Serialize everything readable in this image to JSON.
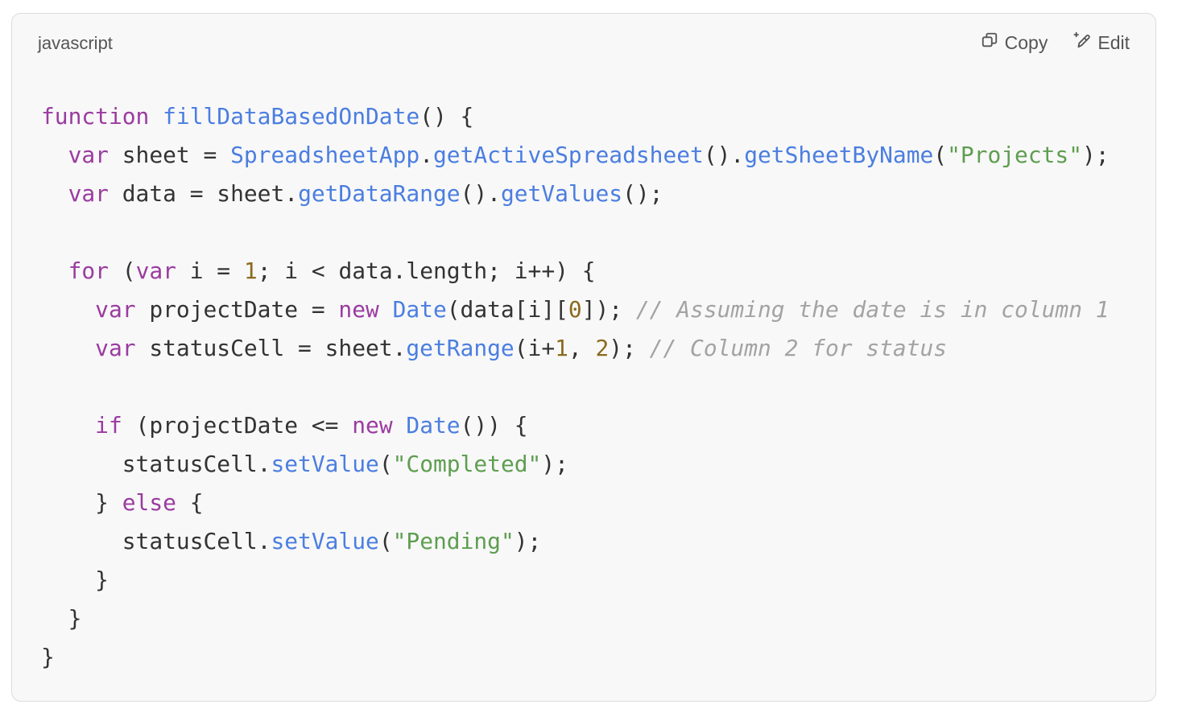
{
  "code_block": {
    "language": "javascript",
    "actions": {
      "copy_label": "Copy",
      "copy_icon": "copy-icon",
      "edit_label": "Edit",
      "edit_icon": "pencil-sparkle-icon"
    },
    "colors": {
      "keyword": "#9a3ba0",
      "function": "#4b7ee0",
      "string": "#5e9e50",
      "number": "#8b6a1e",
      "comment": "#a3a3a3",
      "text": "#333333",
      "background": "#f8f8f8"
    },
    "lines": [
      [
        [
          "kw",
          "function"
        ],
        [
          "",
          " "
        ],
        [
          "fn",
          "fillDataBasedOnDate"
        ],
        [
          "",
          "() {"
        ]
      ],
      [
        [
          "",
          "  "
        ],
        [
          "kw",
          "var"
        ],
        [
          "",
          " sheet = "
        ],
        [
          "fn",
          "SpreadsheetApp"
        ],
        [
          "",
          "."
        ],
        [
          "fn",
          "getActiveSpreadsheet"
        ],
        [
          "",
          "()."
        ],
        [
          "fn",
          "getSheetByName"
        ],
        [
          "",
          "("
        ],
        [
          "str",
          "\"Projects\""
        ],
        [
          "",
          ");"
        ]
      ],
      [
        [
          "",
          "  "
        ],
        [
          "kw",
          "var"
        ],
        [
          "",
          "",
          " data = sheet."
        ],
        [
          "fn",
          "getDataRange"
        ],
        [
          "",
          "()."
        ],
        [
          "fn",
          "getValues"
        ],
        [
          "",
          "();"
        ]
      ],
      [],
      [
        [
          "",
          "  "
        ],
        [
          "kw",
          "for"
        ],
        [
          "",
          " ("
        ],
        [
          "kw",
          "var"
        ],
        [
          "",
          " i = "
        ],
        [
          "num",
          "1"
        ],
        [
          "",
          "; i < data.length; i++) {"
        ]
      ],
      [
        [
          "",
          "    "
        ],
        [
          "kw",
          "var"
        ],
        [
          "",
          " projectDate = "
        ],
        [
          "kw",
          "new"
        ],
        [
          "",
          " "
        ],
        [
          "fn",
          "Date"
        ],
        [
          "",
          "(data[i]["
        ],
        [
          "num",
          "0"
        ],
        [
          "",
          "]); "
        ],
        [
          "cm",
          "// Assuming the date is in column 1"
        ]
      ],
      [
        [
          "",
          "    "
        ],
        [
          "kw",
          "var"
        ],
        [
          "",
          " statusCell = sheet."
        ],
        [
          "fn",
          "getRange"
        ],
        [
          "",
          "(i+"
        ],
        [
          "num",
          "1"
        ],
        [
          "",
          ", "
        ],
        [
          "num",
          "2"
        ],
        [
          "",
          "); "
        ],
        [
          "cm",
          "// Column 2 for status"
        ]
      ],
      [],
      [
        [
          "",
          "    "
        ],
        [
          "kw",
          "if"
        ],
        [
          "",
          " (projectDate <= "
        ],
        [
          "kw",
          "new"
        ],
        [
          "",
          " "
        ],
        [
          "fn",
          "Date"
        ],
        [
          "",
          "()) {"
        ]
      ],
      [
        [
          "",
          "      statusCell."
        ],
        [
          "fn",
          "setValue"
        ],
        [
          "",
          "("
        ],
        [
          "str",
          "\"Completed\""
        ],
        [
          "",
          ");"
        ]
      ],
      [
        [
          "",
          "    } "
        ],
        [
          "kw",
          "else"
        ],
        [
          "",
          " {"
        ]
      ],
      [
        [
          "",
          "      statusCell."
        ],
        [
          "fn",
          "setValue"
        ],
        [
          "",
          "("
        ],
        [
          "str",
          "\"Pending\""
        ],
        [
          "",
          ");"
        ]
      ],
      [
        [
          "",
          "    }"
        ]
      ],
      [
        [
          "",
          "  }"
        ]
      ],
      [
        [
          "",
          "}"
        ]
      ]
    ]
  }
}
